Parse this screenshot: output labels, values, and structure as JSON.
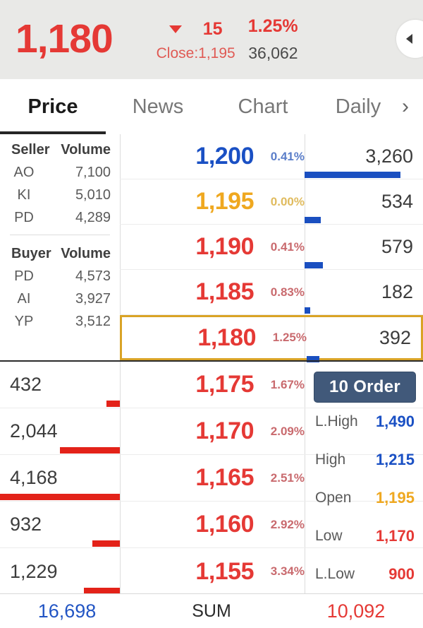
{
  "header": {
    "last_price": "1,180",
    "direction_icon": "triangle-down-icon",
    "change": "15",
    "change_pct": "1.25%",
    "close_label": "Close:1,195",
    "volume": "36,062",
    "nav_icon": "chevron-left-icon",
    "accent_down": "#e53935",
    "accent_up": "#1a50c4",
    "accent_flat": "#efa820"
  },
  "tabs": [
    {
      "label": "Price",
      "active": true
    },
    {
      "label": "News",
      "active": false
    },
    {
      "label": "Chart",
      "active": false
    },
    {
      "label": "Daily",
      "active": false
    }
  ],
  "tabs_more_icon": "chevron-right-icon",
  "broker_panel": {
    "seller": {
      "col_name": "Seller",
      "col_volume": "Volume",
      "rows": [
        {
          "name": "AO",
          "volume": "7,100"
        },
        {
          "name": "KI",
          "volume": "5,010"
        },
        {
          "name": "PD",
          "volume": "4,289"
        }
      ]
    },
    "buyer": {
      "col_name": "Buyer",
      "col_volume": "Volume",
      "rows": [
        {
          "name": "PD",
          "volume": "4,573"
        },
        {
          "name": "AI",
          "volume": "3,927"
        },
        {
          "name": "YP",
          "volume": "3,512"
        }
      ]
    }
  },
  "ask_ladder": [
    {
      "price": "1,200",
      "pct": "0.41%",
      "qty": "3,260",
      "color": "blue",
      "bar_pct": 100,
      "highlight": false
    },
    {
      "price": "1,195",
      "pct": "0.00%",
      "qty": "534",
      "color": "gold",
      "bar_pct": 17,
      "highlight": false
    },
    {
      "price": "1,190",
      "pct": "0.41%",
      "qty": "579",
      "color": "red",
      "bar_pct": 19,
      "highlight": false
    },
    {
      "price": "1,185",
      "pct": "0.83%",
      "qty": "182",
      "color": "red",
      "bar_pct": 6,
      "highlight": false
    },
    {
      "price": "1,180",
      "pct": "1.25%",
      "qty": "392",
      "color": "red",
      "bar_pct": 13,
      "highlight": true
    }
  ],
  "bid_ladder": [
    {
      "price": "1,175",
      "pct": "1.67%",
      "qty": "432",
      "color": "red",
      "bar_pct": 11
    },
    {
      "price": "1,170",
      "pct": "2.09%",
      "qty": "2,044",
      "color": "red",
      "bar_pct": 50
    },
    {
      "price": "1,165",
      "pct": "2.51%",
      "qty": "4,168",
      "color": "red",
      "bar_pct": 100
    },
    {
      "price": "1,160",
      "pct": "2.92%",
      "qty": "932",
      "color": "red",
      "bar_pct": 23
    },
    {
      "price": "1,155",
      "pct": "3.34%",
      "qty": "1,229",
      "color": "red",
      "bar_pct": 30
    }
  ],
  "order_panel": {
    "button_label": "10 Order",
    "stats": [
      {
        "label": "L.High",
        "value": "1,490",
        "color": "blue"
      },
      {
        "label": "High",
        "value": "1,215",
        "color": "blue"
      },
      {
        "label": "Open",
        "value": "1,195",
        "color": "gold"
      },
      {
        "label": "Low",
        "value": "1,170",
        "color": "red"
      },
      {
        "label": "L.Low",
        "value": "900",
        "color": "red"
      }
    ]
  },
  "sum_bar": {
    "bid_total": "16,698",
    "label": "SUM",
    "ask_total": "10,092"
  }
}
